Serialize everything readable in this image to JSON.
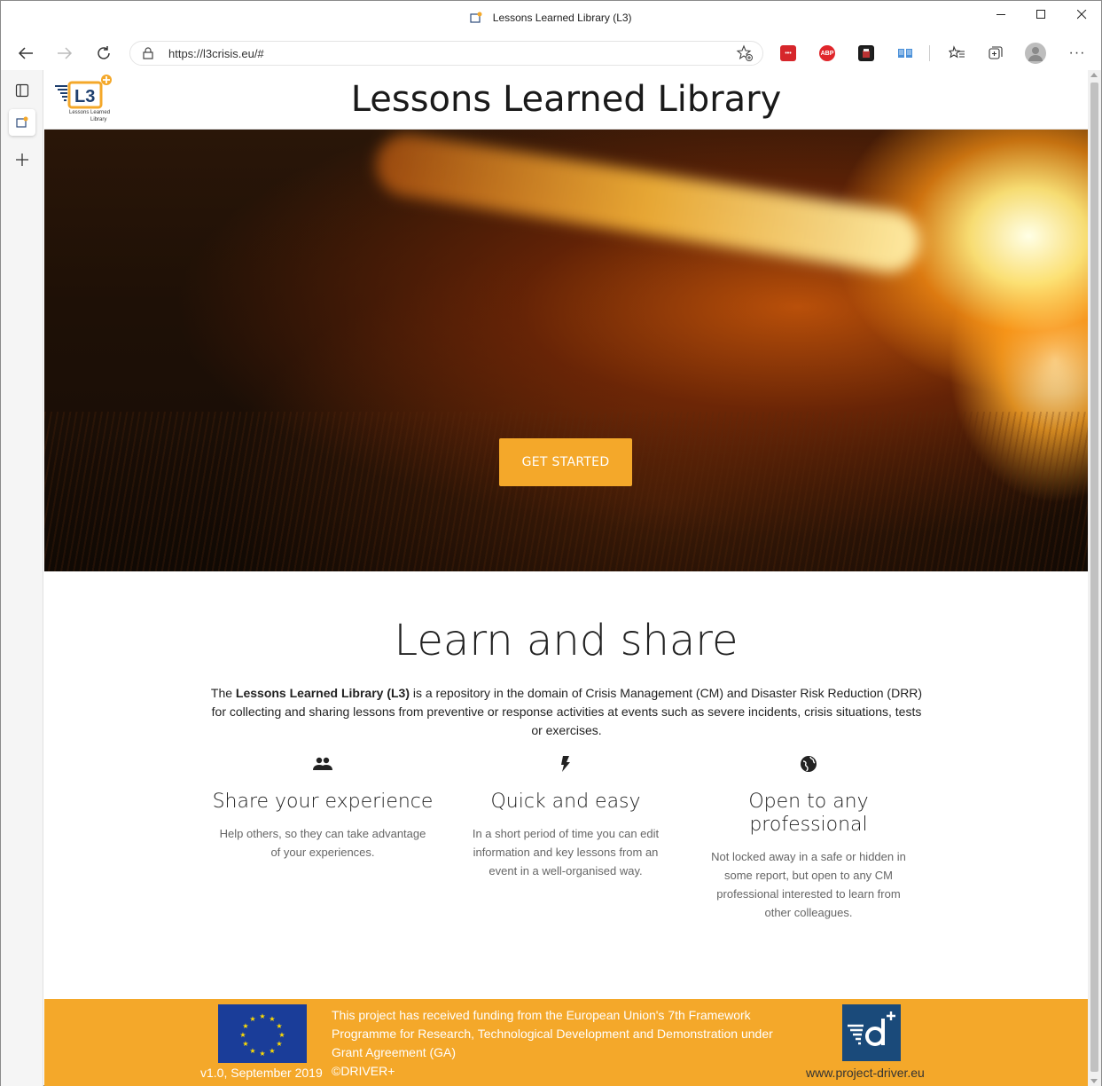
{
  "browser": {
    "window_title": "Lessons Learned Library (L3)",
    "url": "https://l3crisis.eu/#",
    "favicon_text": "L3",
    "extensions": [
      "more-icon",
      "adblock-icon",
      "ext-avatar-icon",
      "reader-icon"
    ],
    "adblock_label": "ABP"
  },
  "site": {
    "title": "Lessons Learned Library",
    "logo_text": "L3",
    "logo_caption_line1": "Lessons Learned",
    "logo_caption_line2": "Library"
  },
  "hero": {
    "cta_label": "GET STARTED"
  },
  "learn": {
    "heading": "Learn and share",
    "intro_prefix": "The ",
    "intro_bold": "Lessons Learned Library (L3)",
    "intro_rest": " is a repository in the domain of Crisis Management (CM) and Disaster Risk Reduction (DRR) for collecting and sharing lessons from preventive or response activities at events such as severe incidents, crisis situations, tests or exercises.",
    "features": [
      {
        "icon": "people-icon",
        "title": "Share your experience",
        "text": "Help others, so they can take advantage of your experiences."
      },
      {
        "icon": "flash-icon",
        "title": "Quick and easy",
        "text": "In a short period of time you can edit information and key lessons from an event in a well-organised way."
      },
      {
        "icon": "globe-icon",
        "title": "Open to any professional",
        "text": "Not locked away in a safe or hidden in some report, but open to any CM professional interested to learn from other colleagues."
      }
    ]
  },
  "footer": {
    "version": "v1.0, September 2019",
    "funding": "This project has received funding from the European Union's 7th Framework Programme for Research, Technological Development and Demonstration under Grant Agreement (GA)",
    "copyright": "©DRIVER+",
    "website": "www.project-driver.eu",
    "brand_color": "#f4a82a",
    "eu_color": "#1a3d99"
  }
}
